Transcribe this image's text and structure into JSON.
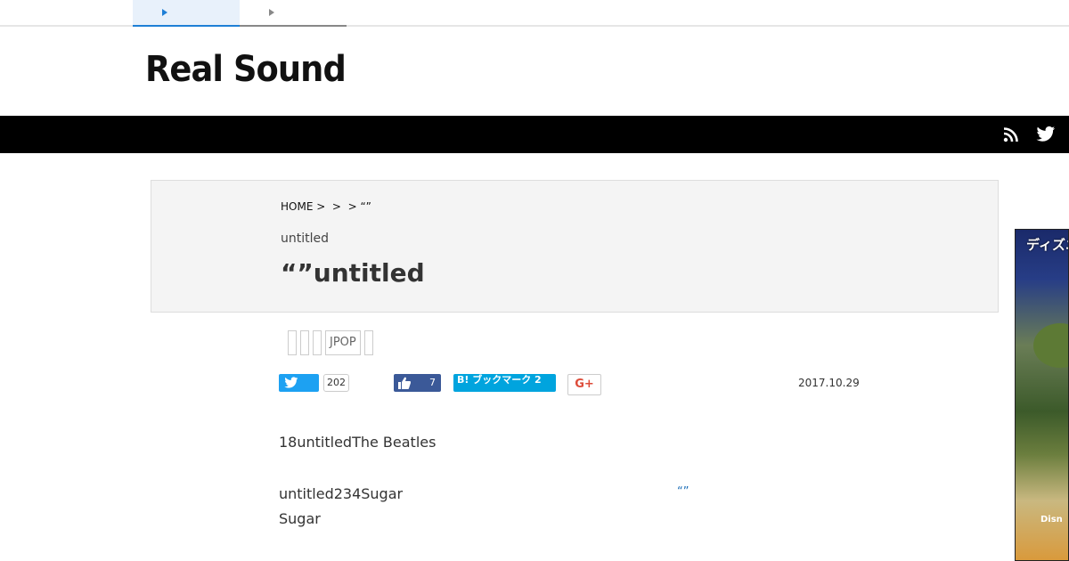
{
  "top_tabs": [
    {
      "label": "",
      "active": true
    },
    {
      "label": "",
      "active": false
    }
  ],
  "logo": "Real Sound",
  "nav_icons": [
    "rss-icon",
    "twitter-icon"
  ],
  "breadcrumb": "HOME >  >  > “”",
  "header": {
    "subtitle": "untitled",
    "title": "“”untitled"
  },
  "tags": [
    "",
    "",
    "",
    "JPOP",
    ""
  ],
  "social": {
    "twitter_count": "202",
    "facebook_count": "7",
    "hatena_label": "B! ブックマーク 2",
    "google_plus_label": "G+"
  },
  "date": "2017.10.29",
  "body": {
    "p1": "18untitledThe Beatles",
    "p2": "untitled234Sugar",
    "quote_link": "“”",
    "p3": "Sugar"
  },
  "ad": {
    "text": "ディズニー",
    "logo": "Disn"
  },
  "colors": {
    "accent": "#1e7fd6",
    "navbar": "#000000",
    "twitter": "#1da1f2",
    "facebook": "#3b5998",
    "hatena": "#00a4de",
    "google_plus": "#dd4b39"
  }
}
